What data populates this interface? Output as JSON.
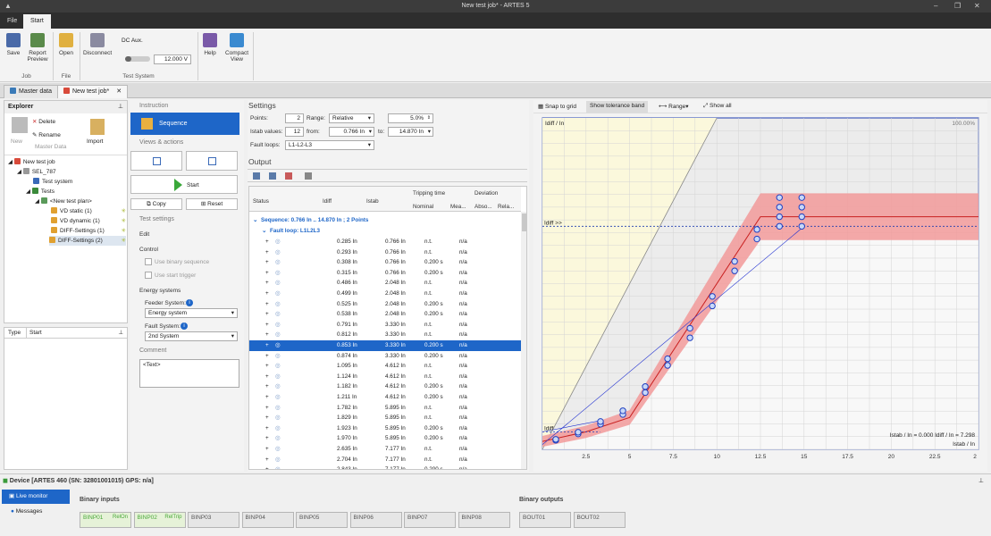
{
  "title_bar": {
    "title": "New test job* - ARTES 5"
  },
  "menu": {
    "file": "File",
    "start": "Start"
  },
  "ribbon": {
    "save": "Save",
    "report_line1": "Report",
    "report_line2": "Preview",
    "open": "Open",
    "disconnect": "Disconnect",
    "dc_aux": "DC Aux.",
    "voltage": "12.000 V",
    "help": "Help",
    "compact_line1": "Compact",
    "compact_line2": "View",
    "group_job": "Job",
    "group_file": "File",
    "group_test_system": "Test System"
  },
  "doc_tabs": {
    "master": "Master data",
    "newjob": "New test job*"
  },
  "explorer": {
    "title": "Explorer",
    "delete": "Delete",
    "rename": "Rename",
    "new": "New",
    "master_data": "Master Data",
    "import": "Import",
    "tree": {
      "root": "New test job",
      "device": "SEL_787",
      "test_system": "Test system",
      "tests": "Tests",
      "plan": "<New test plan>",
      "vd_static": "VD static (1)",
      "vd_dynamic": "VD dynamic (1)",
      "diff1": "DIFF-Settings (1)",
      "diff2": "DIFF-Settings (2)"
    }
  },
  "typepanel": {
    "type": "Type",
    "start": "Start"
  },
  "instruction": {
    "instruction": "Instruction",
    "sequence": "Sequence",
    "views_actions": "Views & actions",
    "start": "Start",
    "copy": "Copy",
    "reset": "Reset",
    "test_settings": "Test settings",
    "edit": "Edit",
    "control": "Control",
    "use_binary": "Use binary sequence",
    "use_start": "Use start trigger",
    "energy_systems": "Energy systems",
    "feeder_system": "Feeder System:",
    "feeder_value": "Energy system",
    "fault_system": "Fault System:",
    "fault_value": "2nd System",
    "comment": "Comment",
    "comment_value": "<Text>"
  },
  "settings": {
    "title": "Settings",
    "points_label": "Points:",
    "points": "2",
    "range_label": "Range:",
    "range": "Relative",
    "percent": "5.0%",
    "istab_label": "Istab values:",
    "istab_count": "12",
    "from_label": "from:",
    "from": "0.766 In",
    "to_label": "to:",
    "to": "14.870 In",
    "fault_loops_label": "Fault loops:",
    "fault_loops": "L1-L2-L3"
  },
  "output": {
    "title": "Output",
    "headers": {
      "status": "Status",
      "idiff": "Idiff",
      "istab": "Istab",
      "tripping": "Tripping time",
      "nominal": "Nominal",
      "mea": "Mea...",
      "deviation": "Deviation",
      "abso": "Abso...",
      "rela": "Rela..."
    },
    "sequence": "Sequence: 0.766 In .. 14.870 In ; 2 Points",
    "fault_loop": "Fault loop: L1L2L3",
    "rows": [
      {
        "idiff": "0.285 In",
        "istab": "0.766 In",
        "nom": "n.t.",
        "mea": "n/a"
      },
      {
        "idiff": "0.293 In",
        "istab": "0.766 In",
        "nom": "n.t.",
        "mea": "n/a"
      },
      {
        "idiff": "0.308 In",
        "istab": "0.766 In",
        "nom": "0.200 s",
        "mea": "n/a"
      },
      {
        "idiff": "0.315 In",
        "istab": "0.766 In",
        "nom": "0.200 s",
        "mea": "n/a"
      },
      {
        "idiff": "0.486 In",
        "istab": "2.048 In",
        "nom": "n.t.",
        "mea": "n/a"
      },
      {
        "idiff": "0.499 In",
        "istab": "2.048 In",
        "nom": "n.t.",
        "mea": "n/a"
      },
      {
        "idiff": "0.525 In",
        "istab": "2.048 In",
        "nom": "0.200 s",
        "mea": "n/a"
      },
      {
        "idiff": "0.538 In",
        "istab": "2.048 In",
        "nom": "0.200 s",
        "mea": "n/a"
      },
      {
        "idiff": "0.791 In",
        "istab": "3.330 In",
        "nom": "n.t.",
        "mea": "n/a"
      },
      {
        "idiff": "0.812 In",
        "istab": "3.330 In",
        "nom": "n.t.",
        "mea": "n/a"
      },
      {
        "idiff": "0.853 In",
        "istab": "3.330 In",
        "nom": "0.200 s",
        "mea": "n/a"
      },
      {
        "idiff": "0.874 In",
        "istab": "3.330 In",
        "nom": "0.200 s",
        "mea": "n/a"
      },
      {
        "idiff": "1.095 In",
        "istab": "4.612 In",
        "nom": "n.t.",
        "mea": "n/a"
      },
      {
        "idiff": "1.124 In",
        "istab": "4.612 In",
        "nom": "n.t.",
        "mea": "n/a"
      },
      {
        "idiff": "1.182 In",
        "istab": "4.612 In",
        "nom": "0.200 s",
        "mea": "n/a"
      },
      {
        "idiff": "1.211 In",
        "istab": "4.612 In",
        "nom": "0.200 s",
        "mea": "n/a"
      },
      {
        "idiff": "1.782 In",
        "istab": "5.895 In",
        "nom": "n.t.",
        "mea": "n/a"
      },
      {
        "idiff": "1.829 In",
        "istab": "5.895 In",
        "nom": "n.t.",
        "mea": "n/a"
      },
      {
        "idiff": "1.923 In",
        "istab": "5.895 In",
        "nom": "0.200 s",
        "mea": "n/a"
      },
      {
        "idiff": "1.970 In",
        "istab": "5.895 In",
        "nom": "0.200 s",
        "mea": "n/a"
      },
      {
        "idiff": "2.635 In",
        "istab": "7.177 In",
        "nom": "n.t.",
        "mea": "n/a"
      },
      {
        "idiff": "2.704 In",
        "istab": "7.177 In",
        "nom": "n.t.",
        "mea": "n/a"
      },
      {
        "idiff": "2.843 In",
        "istab": "7.177 In",
        "nom": "0.200 s",
        "mea": "n/a"
      }
    ]
  },
  "chart_toolbar": {
    "snap": "Snap to grid",
    "tolerance": "Show tolerance band",
    "range": "Range",
    "show_all": "Show all"
  },
  "chart_data": {
    "type": "line",
    "ylabel": "Idiff / In",
    "xlabel": "Istab / In",
    "zoom": "100.00%",
    "idiff_high": "Idiff >>",
    "idiff_low": "Idiff",
    "readout": "Istab / In = 0.000   Idiff / In = 7.298",
    "x_ticks": [
      "2.5",
      "5",
      "7.5",
      "10",
      "12.5",
      "15",
      "17.5",
      "20",
      "22.5",
      "2"
    ],
    "xlim": [
      0,
      25
    ],
    "ylim": [
      0,
      10.4
    ],
    "characteristic": [
      [
        0,
        0.25
      ],
      [
        2.5,
        0.55
      ],
      [
        5,
        1.0
      ],
      [
        12.5,
        7.3
      ],
      [
        25,
        7.3
      ]
    ],
    "idiff_high_level": 7.0,
    "test_points": [
      [
        0.766,
        0.285
      ],
      [
        0.766,
        0.315
      ],
      [
        2.048,
        0.486
      ],
      [
        2.048,
        0.538
      ],
      [
        3.33,
        0.791
      ],
      [
        3.33,
        0.874
      ],
      [
        4.612,
        1.095
      ],
      [
        4.612,
        1.211
      ],
      [
        5.895,
        1.782
      ],
      [
        5.895,
        1.97
      ],
      [
        7.177,
        2.635
      ],
      [
        7.177,
        2.843
      ],
      [
        8.46,
        3.5
      ],
      [
        8.46,
        3.8
      ],
      [
        9.74,
        4.5
      ],
      [
        9.74,
        4.8
      ],
      [
        11.02,
        5.6
      ],
      [
        11.02,
        5.9
      ],
      [
        12.3,
        6.6
      ],
      [
        12.3,
        6.9
      ],
      [
        13.59,
        7.0
      ],
      [
        13.59,
        7.3
      ],
      [
        13.59,
        7.6
      ],
      [
        13.59,
        7.9
      ],
      [
        14.87,
        7.0
      ],
      [
        14.87,
        7.3
      ],
      [
        14.87,
        7.6
      ],
      [
        14.87,
        7.9
      ]
    ]
  },
  "status_bar": {
    "device": "Device [ARTES 460 (SN: 32801001015) GPS: n/a]",
    "live_monitor": "Live monitor",
    "messages": "Messages",
    "binary_inputs": "Binary inputs",
    "binary_outputs": "Binary outputs",
    "inputs": [
      {
        "name": "BINP01",
        "tag": "RelOn"
      },
      {
        "name": "BINP02",
        "tag": "RelTrip"
      },
      {
        "name": "BINP03",
        "tag": ""
      },
      {
        "name": "BINP04",
        "tag": ""
      },
      {
        "name": "BINP05",
        "tag": ""
      },
      {
        "name": "BINP06",
        "tag": ""
      },
      {
        "name": "BINP07",
        "tag": ""
      },
      {
        "name": "BINP08",
        "tag": ""
      }
    ],
    "outputs": [
      {
        "name": "BOUT01"
      },
      {
        "name": "BOUT02"
      }
    ]
  }
}
